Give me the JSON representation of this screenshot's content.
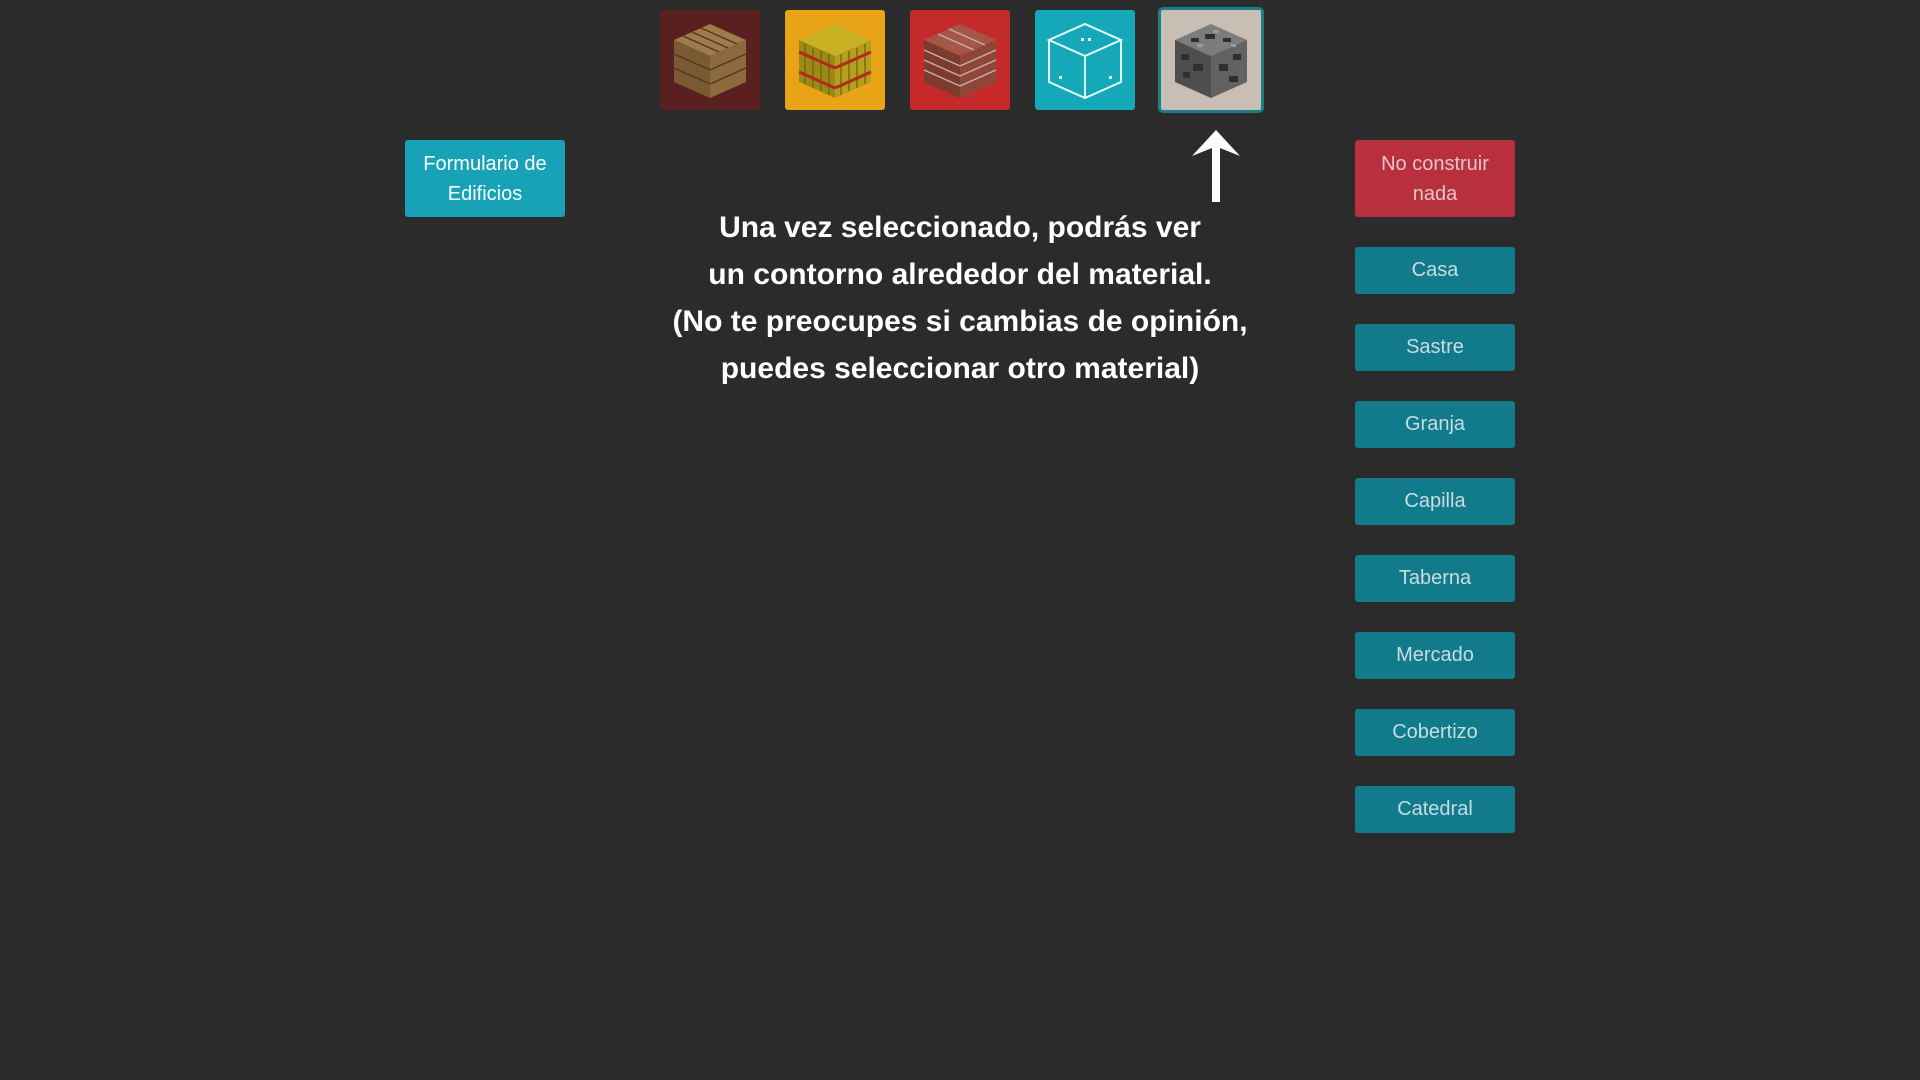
{
  "materials": [
    {
      "name": "wood",
      "bg": "#5a1f1f",
      "selected": false
    },
    {
      "name": "hay",
      "bg": "#e8a317",
      "selected": false
    },
    {
      "name": "brick",
      "bg": "#c42a2a",
      "selected": false
    },
    {
      "name": "glass",
      "bg": "#14a8b8",
      "selected": false
    },
    {
      "name": "cobblestone",
      "bg": "#c9beb4",
      "selected": true
    }
  ],
  "form_button": {
    "label": "Formulario de Edificios"
  },
  "instruction": {
    "line1": "Una vez seleccionado, podrás ver",
    "line2": "un contorno alrededor del material.",
    "line3": "(No te preocupes si cambias de opinión,",
    "line4": "puedes seleccionar otro material)"
  },
  "buildings": {
    "none_label": "No construir nada",
    "items": [
      {
        "label": "Casa"
      },
      {
        "label": "Sastre"
      },
      {
        "label": "Granja"
      },
      {
        "label": "Capilla"
      },
      {
        "label": "Taberna"
      },
      {
        "label": "Mercado"
      },
      {
        "label": "Cobertizo"
      },
      {
        "label": "Catedral"
      }
    ]
  },
  "colors": {
    "background": "#2b2b2b",
    "form_button": "#17a2b8",
    "building_button": "#117a8b",
    "none_button": "#b8303d",
    "selected_outline": "#1a7f86"
  },
  "icons": {
    "arrow": "arrow-up-icon"
  }
}
